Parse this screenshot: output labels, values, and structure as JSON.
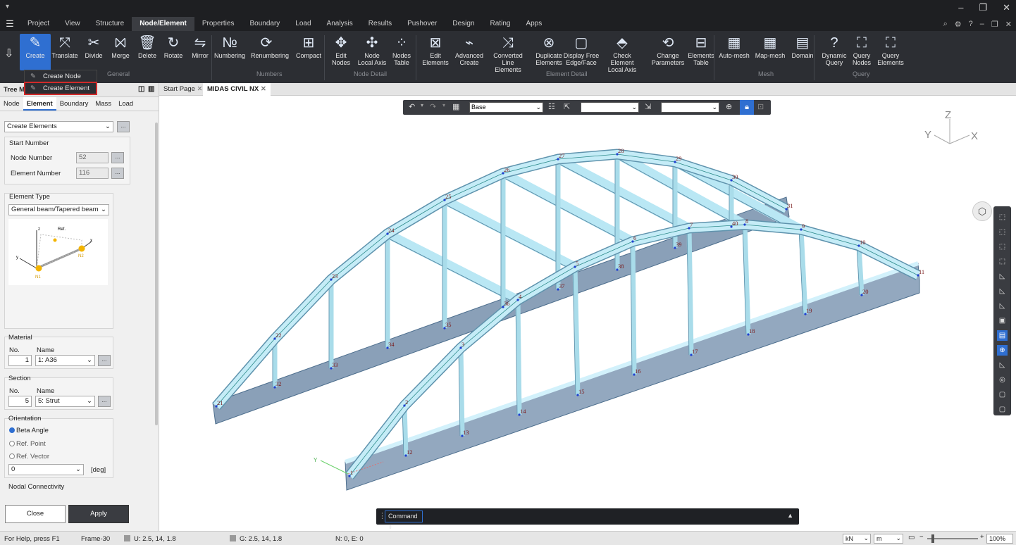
{
  "menu": {
    "items": [
      "Project",
      "View",
      "Structure",
      "Node/Element",
      "Properties",
      "Boundary",
      "Load",
      "Analysis",
      "Results",
      "Pushover",
      "Design",
      "Rating",
      "Apps"
    ],
    "active": "Node/Element"
  },
  "ribbon": {
    "buttons": [
      {
        "label": "Create",
        "icon": "pencil-icon"
      },
      {
        "label": "Translate",
        "icon": "translate-icon"
      },
      {
        "label": "Divide",
        "icon": "divide-icon"
      },
      {
        "label": "Merge",
        "icon": "merge-icon"
      },
      {
        "label": "Delete",
        "icon": "trash-icon"
      },
      {
        "label": "Rotate",
        "icon": "rotate-icon"
      },
      {
        "label": "Mirror",
        "icon": "mirror-icon"
      },
      {
        "label": "Numbering",
        "icon": "numbering-icon"
      },
      {
        "label": "Renumbering",
        "icon": "renumbering-icon"
      },
      {
        "label": "Compact",
        "icon": "compact-icon"
      },
      {
        "label": "Edit Nodes",
        "icon": "edit-nodes-icon"
      },
      {
        "label": "Node Local Axis",
        "icon": "node-axis-icon"
      },
      {
        "label": "Nodes Table",
        "icon": "nodes-table-icon"
      },
      {
        "label": "Edit Elements",
        "icon": "edit-elements-icon"
      },
      {
        "label": "Advanced Create",
        "icon": "advanced-create-icon"
      },
      {
        "label": "Converted Line Elements",
        "icon": "converted-line-icon"
      },
      {
        "label": "Duplicate Elements",
        "icon": "duplicate-icon"
      },
      {
        "label": "Display Free Edge/Face",
        "icon": "free-edge-icon"
      },
      {
        "label": "Check Element Local Axis",
        "icon": "check-axis-icon"
      },
      {
        "label": "Change Parameters",
        "icon": "change-params-icon"
      },
      {
        "label": "Elements Table",
        "icon": "elements-table-icon"
      },
      {
        "label": "Auto-mesh",
        "icon": "auto-mesh-icon"
      },
      {
        "label": "Map-mesh",
        "icon": "map-mesh-icon"
      },
      {
        "label": "Domain",
        "icon": "domain-icon"
      },
      {
        "label": "Dynamic Query",
        "icon": "dynamic-query-icon"
      },
      {
        "label": "Query Nodes",
        "icon": "query-nodes-icon"
      },
      {
        "label": "Query Elements",
        "icon": "query-elements-icon"
      }
    ],
    "groups": [
      "General",
      "Numbers",
      "Node Detail",
      "Element Detail",
      "Mesh",
      "Query"
    ]
  },
  "create_dropdown": {
    "items": [
      "Create Node",
      "Create Element"
    ],
    "highlighted": "Create Element"
  },
  "panel": {
    "title": "Tree Me",
    "tabs": [
      "Node",
      "Element",
      "Boundary",
      "Mass",
      "Load"
    ],
    "active_tab": "Element",
    "mode": "Create Elements",
    "start_number": {
      "title": "Start Number",
      "node_label": "Node Number",
      "node_value": "52",
      "element_label": "Element Number",
      "element_value": "116"
    },
    "element_type": {
      "title": "Element Type",
      "value": "General beam/Tapered beam",
      "diagram": {
        "ref": "Ref.",
        "n1": "N1",
        "n2": "N2",
        "x": "x",
        "y": "y",
        "z": "z"
      }
    },
    "material": {
      "title": "Material",
      "no_label": "No.",
      "name_label": "Name",
      "no": "1",
      "name": "1: A36"
    },
    "section": {
      "title": "Section",
      "no_label": "No.",
      "name_label": "Name",
      "no": "5",
      "name": "5: Strut"
    },
    "orientation": {
      "title": "Orientation",
      "options": [
        "Beta Angle",
        "Ref. Point",
        "Ref. Vector"
      ],
      "selected": "Beta Angle",
      "angle": "0",
      "unit": "[deg]"
    },
    "connectivity": {
      "title": "Nodal Connectivity"
    },
    "close_label": "Close",
    "apply_label": "Apply"
  },
  "view_tabs": [
    "Start Page",
    "MIDAS CIVIL NX"
  ],
  "view_toolbar": {
    "select1": "Base",
    "select2": "",
    "select3": ""
  },
  "axis": {
    "x": "X",
    "y": "Y",
    "z": "Z"
  },
  "node_labels": [
    {
      "t": "21",
      "a": "s1",
      "i": 0
    },
    {
      "t": "22",
      "a": "s1",
      "i": 1
    },
    {
      "t": "23",
      "a": "s1",
      "i": 2
    },
    {
      "t": "24",
      "a": "s1",
      "i": 3
    },
    {
      "t": "25",
      "a": "s1",
      "i": 4
    },
    {
      "t": "26",
      "a": "s1",
      "i": 5
    },
    {
      "t": "27",
      "a": "s1",
      "i": 6
    },
    {
      "t": "28",
      "a": "s1",
      "i": 7
    },
    {
      "t": "29",
      "a": "s1",
      "i": 8
    },
    {
      "t": "30",
      "a": "s1",
      "i": 9
    },
    {
      "t": "31",
      "a": "s1",
      "i": 10
    },
    {
      "t": "1",
      "a": "s2",
      "i": 0
    },
    {
      "t": "2",
      "a": "s2",
      "i": 1
    },
    {
      "t": "3",
      "a": "s2",
      "i": 2
    },
    {
      "t": "4",
      "a": "s2",
      "i": 3
    },
    {
      "t": "5",
      "a": "s2",
      "i": 4
    },
    {
      "t": "6",
      "a": "s2",
      "i": 5
    },
    {
      "t": "7",
      "a": "s2",
      "i": 6
    },
    {
      "t": "8",
      "a": "s2",
      "i": 7
    },
    {
      "t": "9",
      "a": "s2",
      "i": 8
    },
    {
      "t": "10",
      "a": "s2",
      "i": 9
    },
    {
      "t": "11",
      "a": "s2",
      "i": 10
    },
    {
      "t": "32",
      "a": "d1",
      "i": 1
    },
    {
      "t": "33",
      "a": "d1",
      "i": 2
    },
    {
      "t": "34",
      "a": "d1",
      "i": 3
    },
    {
      "t": "35",
      "a": "d1",
      "i": 4
    },
    {
      "t": "36",
      "a": "d1",
      "i": 5
    },
    {
      "t": "37",
      "a": "d1",
      "i": 6
    },
    {
      "t": "38",
      "a": "d1",
      "i": 7
    },
    {
      "t": "39",
      "a": "d1",
      "i": 8
    },
    {
      "t": "40",
      "a": "d1",
      "i": 9
    },
    {
      "t": "12",
      "a": "d2",
      "i": 1
    },
    {
      "t": "13",
      "a": "d2",
      "i": 2
    },
    {
      "t": "14",
      "a": "d2",
      "i": 3
    },
    {
      "t": "15",
      "a": "d2",
      "i": 4
    },
    {
      "t": "16",
      "a": "d2",
      "i": 5
    },
    {
      "t": "17",
      "a": "d2",
      "i": 6
    },
    {
      "t": "18",
      "a": "d2",
      "i": 7
    },
    {
      "t": "19",
      "a": "d2",
      "i": 8
    },
    {
      "t": "20",
      "a": "d2",
      "i": 9
    }
  ],
  "command": {
    "label": "Command"
  },
  "status": {
    "help": "For Help, press F1",
    "frame": "Frame-30",
    "u": "U: 2.5, 14, 1.8",
    "g": "G: 2.5, 14, 1.8",
    "n": "N: 0, E: 0",
    "force_unit": "kN",
    "length_unit": "m",
    "zoom": "100%"
  }
}
